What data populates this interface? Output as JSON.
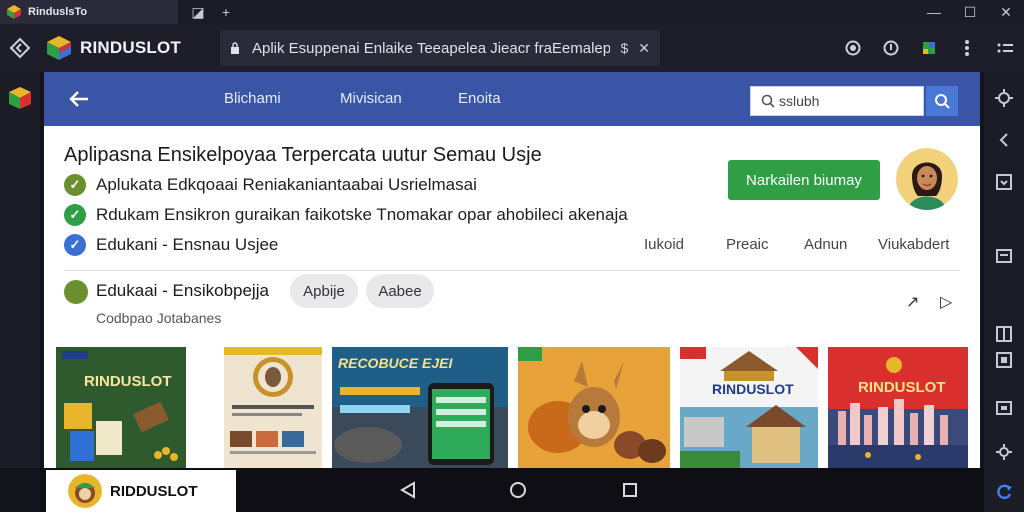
{
  "window": {
    "tab_title": "RinduslsTo",
    "tab_actions": [
      "◪",
      "+"
    ],
    "controls": [
      "—",
      "☐",
      "✕"
    ]
  },
  "browser": {
    "brand": "RINDUSLOT",
    "url": "Aplik Esuppenai Enlaike Teeapelea Jieacr fraEemalepedOe",
    "url_actions": [
      "$",
      "✕"
    ]
  },
  "appbar": {
    "tabs": [
      "Blichami",
      "Mivisican",
      "Enoita"
    ],
    "search_value": "sslubh"
  },
  "hero": {
    "title": "Aplipasna Ensikelpoyaa Terpercata uutur Semau Usje",
    "features": [
      {
        "text": "Aplukata Edkqoaai Reniakaniantaabai Usrielmasai",
        "icon_color": "#6a8f2e"
      },
      {
        "text": "Rdukam Ensikron guraikan faikotske Tnomakar opar ahobileci akenaja",
        "icon_color": "#2f9e44"
      },
      {
        "text": "Edukani - Ensnau Usjee",
        "icon_color": "#3b6fd6"
      }
    ],
    "install_label": "Narkailen biumay",
    "meta": [
      "Iukoid",
      "Preaic",
      "Adnun",
      "Viukabdert"
    ]
  },
  "section": {
    "title": "Edukaai - Ensikobpejja",
    "chips": [
      "Apbije",
      "Aabee"
    ],
    "subtitle": "Codbpao Jotabanes",
    "arrows": [
      "↗",
      "▷"
    ]
  },
  "cards": [
    {
      "label": "RINDUSLOT",
      "bg": "#2f5a2e"
    },
    {
      "label": "",
      "bg": "#efe4cf"
    },
    {
      "label": "RECOBUCE EJEI",
      "bg": "#1f5e86"
    },
    {
      "label": "",
      "bg": "#e8a23a"
    },
    {
      "label": "RINDUSLOT",
      "bg": "#ffffff"
    },
    {
      "label": "RINDUSLOT",
      "bg": "#d9302e"
    }
  ],
  "bottom_bar": {
    "app_label": "RIDDUSLOT"
  },
  "colors": {
    "appbar": "#3b55a6",
    "install_button": "#2f9e44",
    "search_button": "#4a78d6"
  }
}
